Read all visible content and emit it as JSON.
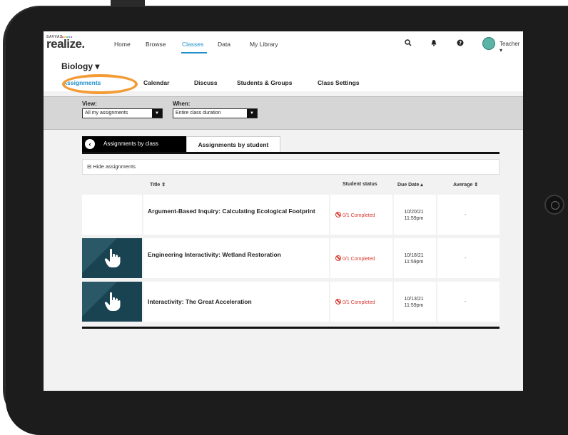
{
  "brand": {
    "small": "SAVVAS",
    "main": "realize.",
    "dot_colors": [
      "#e8473b",
      "#f7b32b",
      "#3ab54a",
      "#1f8fc8",
      "#8e44ad"
    ]
  },
  "nav": {
    "home": "Home",
    "browse": "Browse",
    "classes": "Classes",
    "data": "Data",
    "library": "My Library"
  },
  "header_icons": [
    "search-icon",
    "bell-icon",
    "help-icon"
  ],
  "user": {
    "name": "Teacher ▾"
  },
  "class": {
    "title": "Biology ▾"
  },
  "subnav": {
    "assignments": "Assignments",
    "calendar": "Calendar",
    "discuss": "Discuss",
    "students": "Students & Groups",
    "settings": "Class Settings"
  },
  "filters": {
    "view_label": "View:",
    "view_value": "All my assignments",
    "when_label": "When:",
    "when_value": "Entire class duration",
    "arrow": "▼"
  },
  "toggle": {
    "back": "‹",
    "by_class": "Assignments by class",
    "by_student": "Assignments by student"
  },
  "hide": "⊟ Hide assignments",
  "columns": {
    "title": "Title ⇕",
    "status": "Student status",
    "due": "Due Date ▴",
    "average": "Average ⇕"
  },
  "rows": [
    {
      "title": "Argument-Based Inquiry: Calculating Ecological Footprint",
      "status": "0/1 Completed",
      "due_date": "10/20/21",
      "due_time": "11:59pm",
      "average": "-",
      "thumb": "blank"
    },
    {
      "title": "Engineering Interactivity: Wetland Restoration",
      "status": "0/1 Completed",
      "due_date": "10/18/21",
      "due_time": "11:59pm",
      "average": "-",
      "thumb": "interactivity"
    },
    {
      "title": "Interactivity: The Great Acceleration",
      "status": "0/1 Completed",
      "due_date": "10/13/21",
      "due_time": "11:59pm",
      "average": "-",
      "thumb": "interactivity"
    }
  ],
  "colors": {
    "accent": "#1f8fc8",
    "highlight": "#f39b35",
    "status": "#d9362b"
  }
}
